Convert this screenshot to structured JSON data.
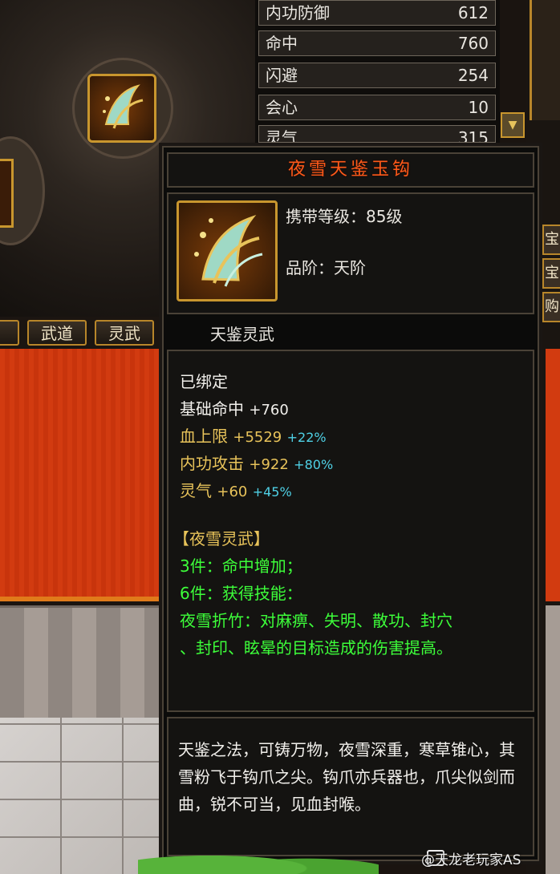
{
  "stats_panel": {
    "rows": [
      {
        "name": "内功防御",
        "value": "612"
      },
      {
        "name": "命中",
        "value": "760"
      },
      {
        "name": "闪避",
        "value": "254"
      },
      {
        "name": "会心",
        "value": "10"
      },
      {
        "name": "灵气",
        "value": "315"
      }
    ]
  },
  "tabs": [
    "武道",
    "灵武"
  ],
  "right_tabs": [
    "宝",
    "宝",
    "购"
  ],
  "tooltip": {
    "title": "夜雪天鉴玉钩",
    "carry_level": "携带等级：85级",
    "grade": "品阶：天阶",
    "category": "天鉴灵武",
    "bound": "已绑定",
    "base_stat": {
      "label": "基础命中",
      "value": "+760"
    },
    "attrs": [
      {
        "label": "血上限",
        "value": "+5529",
        "pct": "+22%"
      },
      {
        "label": "内功攻击",
        "value": "+922",
        "pct": "+80%"
      },
      {
        "label": "灵气",
        "value": "+60",
        "pct": "+45%"
      }
    ],
    "set_name": "【夜雪灵武】",
    "set_bonus_3": "3件：命中增加；",
    "set_bonus_6": "6件：获得技能：",
    "skill_line1": "夜雪折竹：对麻痹、失明、散功、封穴",
    "skill_line2": "、封印、眩晕的目标造成的伤害提高。",
    "description": "天鉴之法，可铸万物，夜雪深重，寒草锥心，其雪粉飞于钩爪之尖。钩爪亦兵器也，爪尖似剑而曲，锐不可当，见血封喉。"
  },
  "watermark": "@天龙老玩家AS",
  "colors": {
    "title": "#ff5a1a",
    "gold": "#e8c35a",
    "cyan": "#4fd1e6",
    "green": "#3dff3a",
    "border_gold": "#c8962e"
  }
}
